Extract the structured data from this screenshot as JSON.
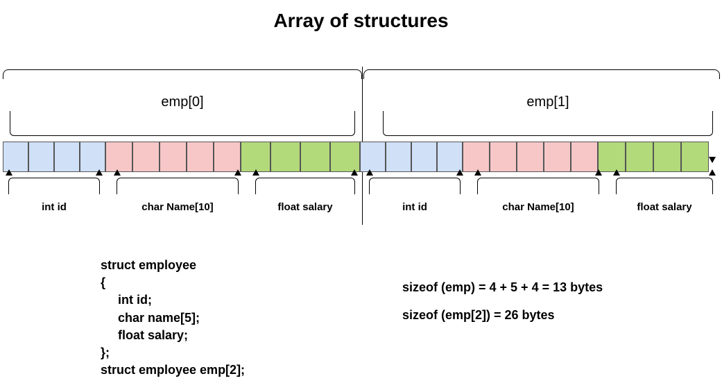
{
  "title": "Array of structures",
  "elements": {
    "emp0": "emp[0]",
    "emp1": "emp[1]"
  },
  "fields": {
    "id": "int id",
    "name": "char Name[10]",
    "salary": "float salary"
  },
  "code": "struct employee\n{\n     int id;\n     char name[5];\n     float salary;\n};\nstruct employee emp[2];",
  "sizes": "sizeof (emp) = 4 + 5 + 4 = 13 bytes\nsizeof (emp[2]) = 26 bytes",
  "chart_data": {
    "type": "diagram",
    "description": "Memory layout of an array of 2 struct employee",
    "struct": {
      "name": "employee",
      "members": [
        {
          "name": "id",
          "type": "int",
          "bytes": 4,
          "color": "#cfe0f7"
        },
        {
          "name": "name",
          "type": "char[5]",
          "bytes": 5,
          "color": "#f7c7c7"
        },
        {
          "name": "salary",
          "type": "float",
          "bytes": 4,
          "color": "#b2d97a"
        }
      ],
      "sizeof_single": 13,
      "array_length": 2,
      "sizeof_array": 26
    },
    "array_elements": [
      "emp[0]",
      "emp[1]"
    ],
    "field_labels_shown": [
      "int id",
      "char Name[10]",
      "float salary"
    ]
  }
}
